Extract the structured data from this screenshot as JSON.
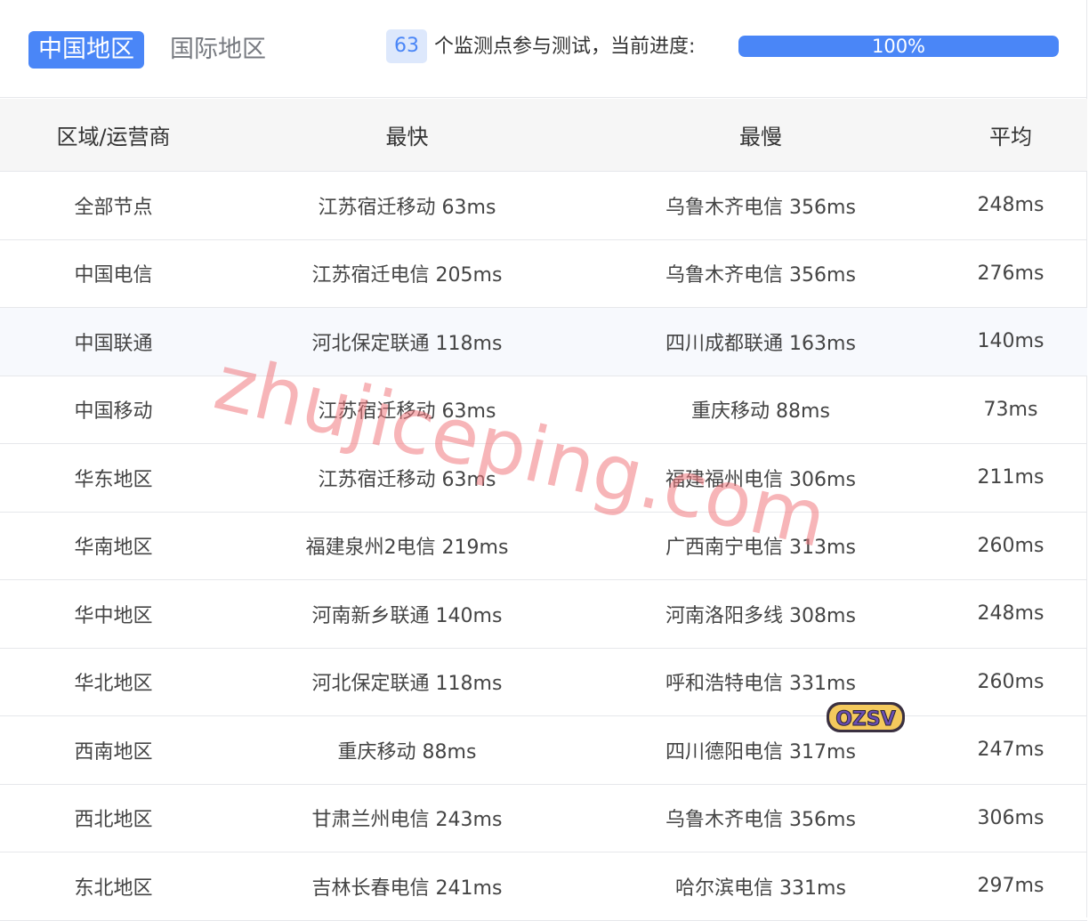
{
  "tabs": [
    {
      "label": "中国地区",
      "active": true
    },
    {
      "label": "国际地区",
      "active": false
    }
  ],
  "summary": {
    "count": "63",
    "text": "个监测点参与测试，当前进度:",
    "progress_label": "100%",
    "progress_percent": 100
  },
  "table": {
    "headers": [
      "区域/运营商",
      "最快",
      "最慢",
      "平均"
    ],
    "rows": [
      [
        "全部节点",
        "江苏宿迁移动 63ms",
        "乌鲁木齐电信 356ms",
        "248ms"
      ],
      [
        "中国电信",
        "江苏宿迁电信 205ms",
        "乌鲁木齐电信 356ms",
        "276ms"
      ],
      [
        "中国联通",
        "河北保定联通 118ms",
        "四川成都联通 163ms",
        "140ms"
      ],
      [
        "中国移动",
        "江苏宿迁移动 63ms",
        "重庆移动 88ms",
        "73ms"
      ],
      [
        "华东地区",
        "江苏宿迁移动 63ms",
        "福建福州电信 306ms",
        "211ms"
      ],
      [
        "华南地区",
        "福建泉州2电信 219ms",
        "广西南宁电信 313ms",
        "260ms"
      ],
      [
        "华中地区",
        "河南新乡联通 140ms",
        "河南洛阳多线 308ms",
        "248ms"
      ],
      [
        "华北地区",
        "河北保定联通 118ms",
        "呼和浩特电信 331ms",
        "260ms"
      ],
      [
        "西南地区",
        "重庆移动 88ms",
        "四川德阳电信 317ms",
        "247ms"
      ],
      [
        "西北地区",
        "甘肃兰州电信 243ms",
        "乌鲁木齐电信 356ms",
        "306ms"
      ],
      [
        "东北地区",
        "吉林长春电信 241ms",
        "哈尔滨电信 331ms",
        "297ms"
      ]
    ]
  },
  "watermark": "zhujiceping.com",
  "logo": "OZSV",
  "colors": {
    "accent": "#4a86f7",
    "badge_bg": "#dde8fc",
    "header_bg": "#f6f6f6",
    "watermark": "#f0787d"
  },
  "icons": []
}
